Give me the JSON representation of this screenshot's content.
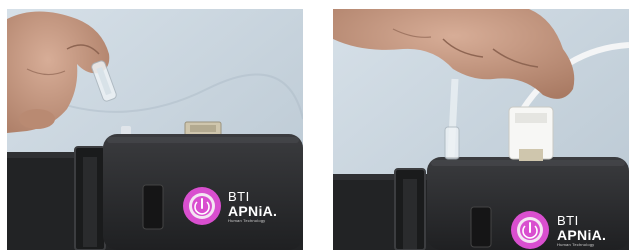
{
  "photos": [
    {
      "caption_hidden": "",
      "device": {
        "brand_line1": "BTI",
        "brand_line2": "APNiA.",
        "brand_tagline": "Human Technology",
        "button_color": "#d94fcf",
        "body_color": "#2b2b2d"
      }
    },
    {
      "caption_hidden": "",
      "device": {
        "brand_line1": "BTI",
        "brand_line2": "APNiA.",
        "brand_tagline": "Human Technology",
        "button_color": "#d94fcf",
        "body_color": "#2b2b2d"
      }
    }
  ],
  "colors": {
    "shirt": "#c9d5de",
    "strap": "#232426",
    "skin": "#c79a83"
  }
}
